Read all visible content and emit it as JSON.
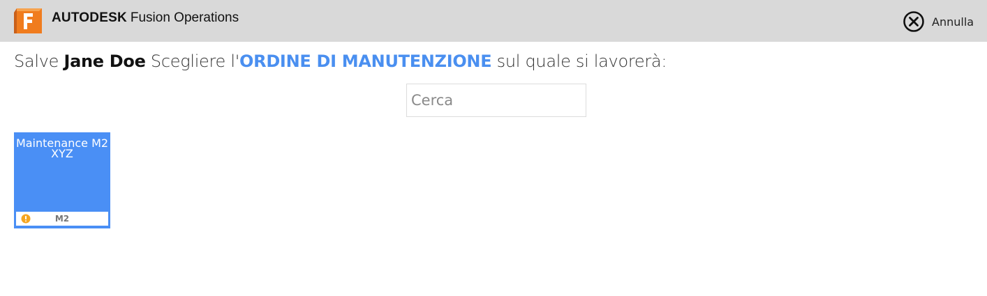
{
  "header": {
    "brand": "AUTODESK",
    "product": "Fusion Operations",
    "logo_letter": "F",
    "logo_colors": [
      "#e8a54a",
      "#f07c1e",
      "#d9661a"
    ],
    "background": "#d9d9d9",
    "cancel_label": "Annulla",
    "cancel_icon": "close-circle-icon"
  },
  "prompt": {
    "greeting": "Salve",
    "user_name": "Jane Doe",
    "instruction": "Scegliere l'",
    "highlight": "ORDINE DI MANUTENZIONE",
    "suffix": "sul quale si lavorerà:",
    "highlight_color": "#4a8ff0"
  },
  "search": {
    "placeholder": "Cerca",
    "value": ""
  },
  "orders": [
    {
      "title": "Maintenance M2 XYZ",
      "code": "M2",
      "status_icon": "warning-icon",
      "status_color": "#f5a623",
      "card_color": "#4a8ff5"
    }
  ]
}
